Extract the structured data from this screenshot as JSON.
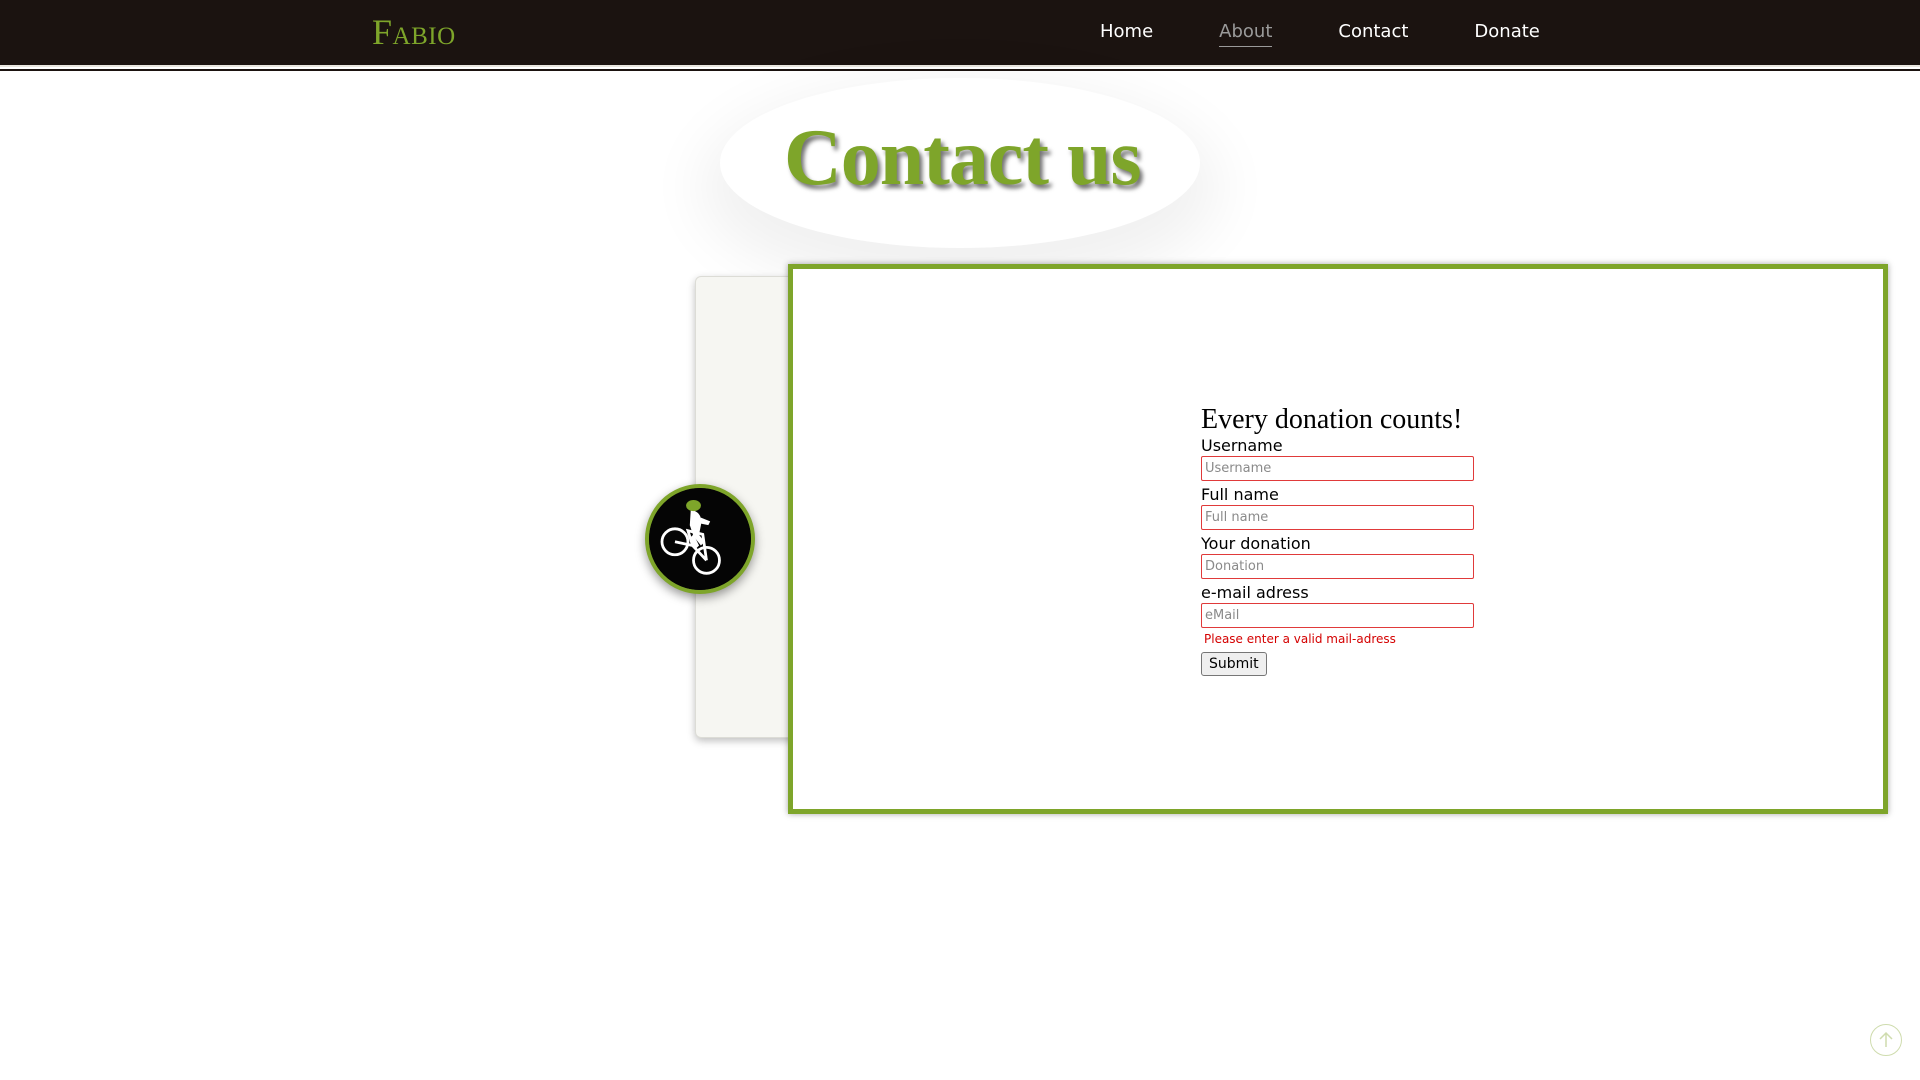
{
  "header": {
    "logo": "Fabio",
    "nav": [
      "Home",
      "About",
      "Contact",
      "Donate"
    ],
    "active_nav": "About"
  },
  "page": {
    "title": "Contact us"
  },
  "form": {
    "title": "Every donation counts!",
    "fields": [
      {
        "label": "Username",
        "placeholder": "Username",
        "value": ""
      },
      {
        "label": "Full name",
        "placeholder": "Full name",
        "value": ""
      },
      {
        "label": "Your donation",
        "placeholder": "Donation",
        "value": ""
      },
      {
        "label": "e-mail adress",
        "placeholder": "eMail",
        "value": ""
      }
    ],
    "error": "Please enter a valid mail-adress",
    "submit_label": "Submit"
  },
  "icons": {
    "avatar": "cyclist-icon",
    "scroll_top": "arrow-up-icon"
  },
  "colors": {
    "brand_green": "#7ea52a",
    "header_bg": "#1b1310",
    "error_red": "#d40000",
    "input_border_error": "#e03a3a"
  }
}
